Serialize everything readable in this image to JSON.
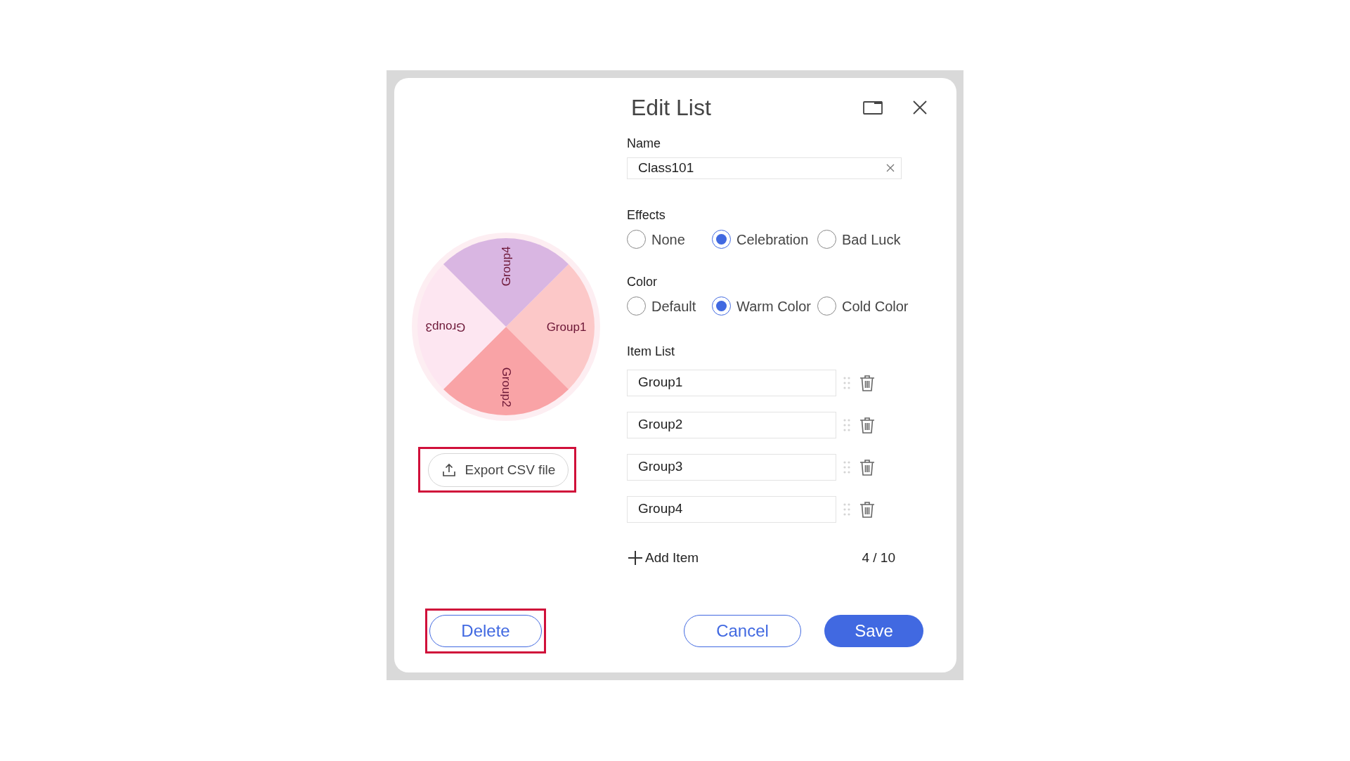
{
  "dialog": {
    "title": "Edit List"
  },
  "wheel": {
    "segments": [
      {
        "label": "Group1",
        "color": "#fcc8c8"
      },
      {
        "label": "Group2",
        "color": "#f9a3a6"
      },
      {
        "label": "Group3",
        "color": "#fde6f1"
      },
      {
        "label": "Group4",
        "color": "#d9b6e2"
      }
    ]
  },
  "export_button": {
    "label": "Export CSV file",
    "highlighted": true
  },
  "name_field": {
    "label": "Name",
    "value": "Class101"
  },
  "effects": {
    "label": "Effects",
    "options": [
      {
        "label": "None",
        "selected": false
      },
      {
        "label": "Celebration",
        "selected": true
      },
      {
        "label": "Bad Luck",
        "selected": false
      }
    ]
  },
  "color": {
    "label": "Color",
    "options": [
      {
        "label": "Default",
        "selected": false
      },
      {
        "label": "Warm Color",
        "selected": true
      },
      {
        "label": "Cold Color",
        "selected": false
      }
    ]
  },
  "item_list": {
    "label": "Item List",
    "items": [
      {
        "value": "Group1"
      },
      {
        "value": "Group2"
      },
      {
        "value": "Group3"
      },
      {
        "value": "Group4"
      }
    ]
  },
  "add_item": {
    "label": "Add Item"
  },
  "count": "4 / 10",
  "buttons": [
    {
      "kind": "delete",
      "label": "Delete",
      "highlighted": true
    },
    {
      "kind": "cancel",
      "label": "Cancel",
      "highlighted": false
    },
    {
      "kind": "save",
      "label": "Save",
      "highlighted": false
    }
  ]
}
